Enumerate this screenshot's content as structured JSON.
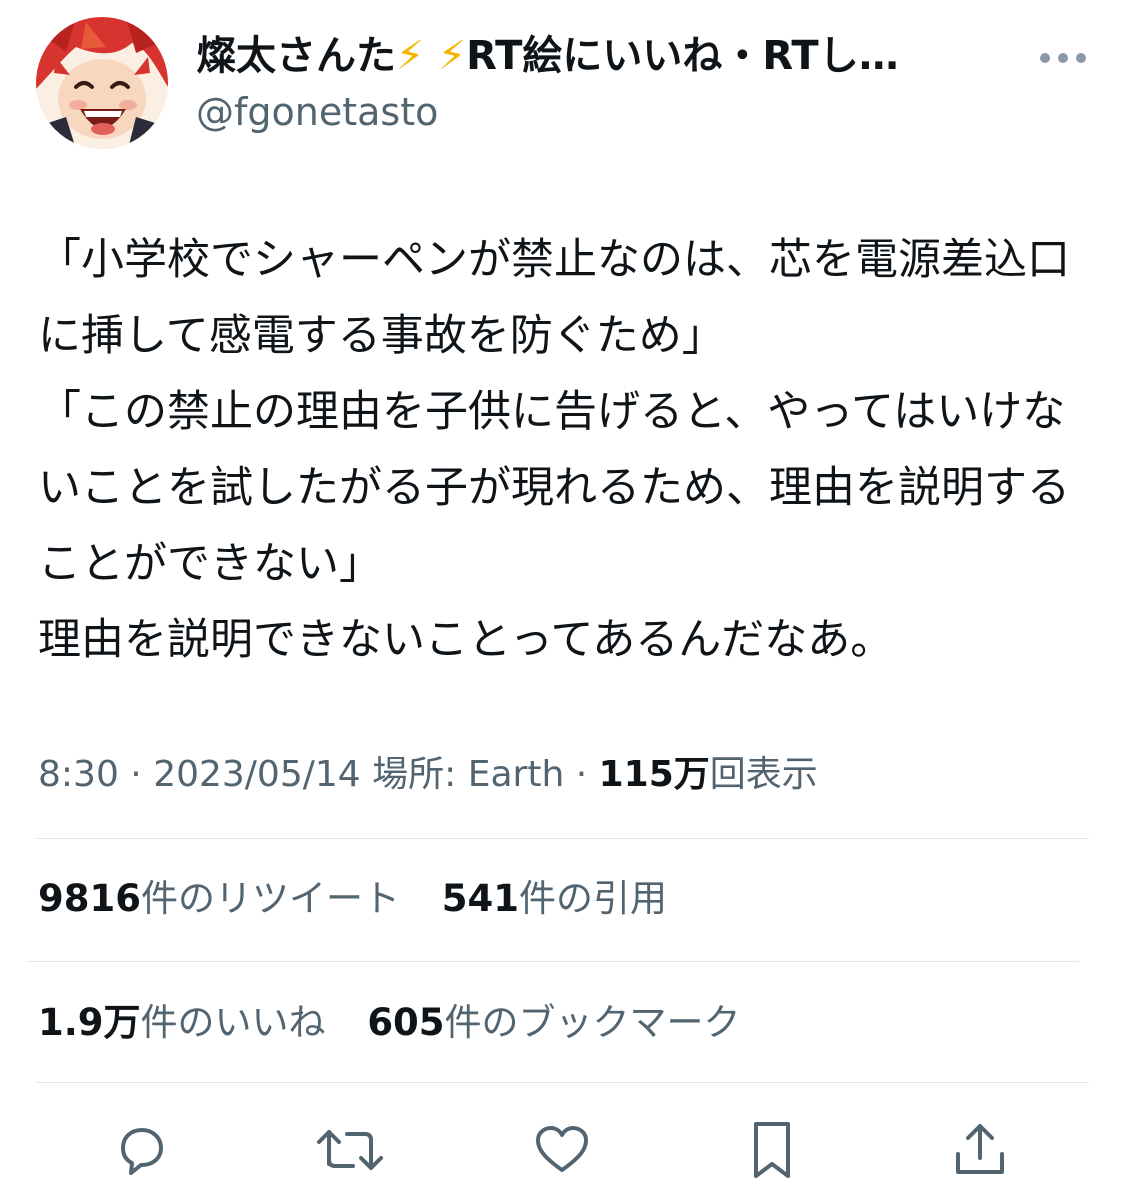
{
  "user": {
    "display_name": "燦太さんた",
    "bolt1": "⚡",
    "bolt2": "⚡",
    "display_name_rest": "RT絵にいいね・RTし…",
    "handle": "@fgonetasto"
  },
  "tweet": {
    "text": "「小学校でシャーペンが禁止なのは、芯を電源差込口に挿して感電する事故を防ぐため」\n「この禁止の理由を子供に告げると、やってはいけないことを試したがる子が現れるため、理由を説明することができない」\n理由を説明できないことってあるんだなあ。"
  },
  "meta": {
    "time": "8:30",
    "sep1": " · ",
    "date": "2023/05/14",
    "location_label": " 場所: ",
    "location": "Earth",
    "sep2": " · ",
    "views_count": "115万",
    "views_label": "回表示"
  },
  "stats": {
    "retweets_count": "9816",
    "retweets_label": "件のリツイート",
    "quotes_count": "541",
    "quotes_label": "件の引用",
    "likes_count": "1.9万",
    "likes_label": "件のいいね",
    "bookmarks_count": "605",
    "bookmarks_label": "件のブックマーク"
  },
  "actions": {
    "reply_icon": "reply-icon",
    "retweet_icon": "retweet-icon",
    "like_icon": "heart-icon",
    "bookmark_icon": "bookmark-icon",
    "share_icon": "share-icon"
  },
  "colors": {
    "text": "#0f1419",
    "secondary": "#536471",
    "divider": "#e1e8ed",
    "bolt": "#f4b400",
    "icon": "#536471"
  }
}
